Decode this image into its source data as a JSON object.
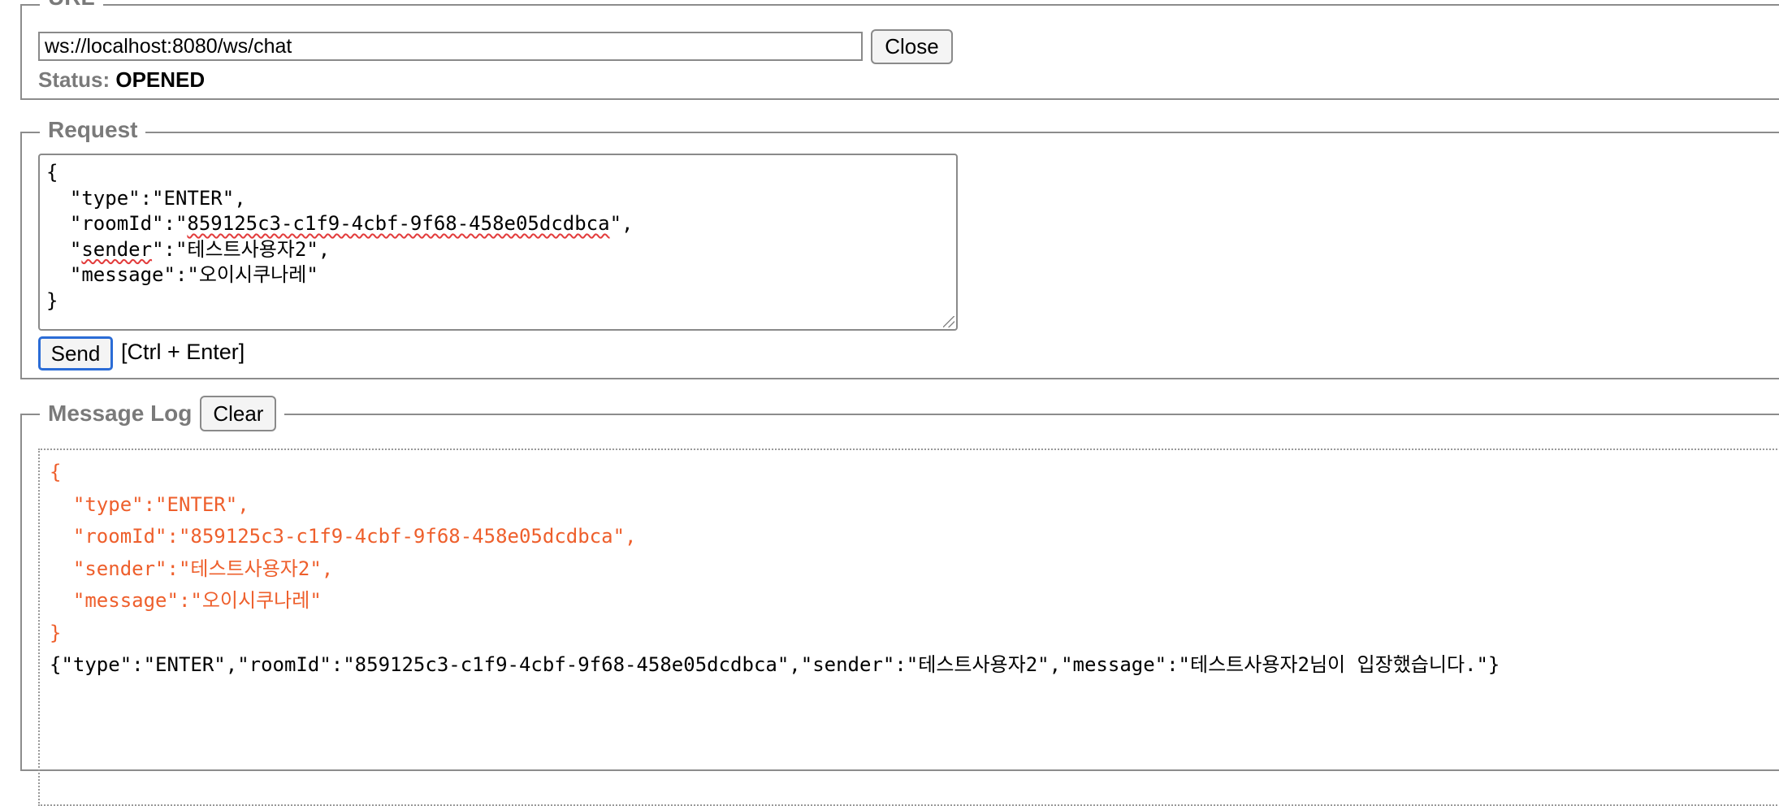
{
  "url_section": {
    "legend": "URL",
    "url_value": "ws://localhost:8080/ws/chat",
    "close_label": "Close",
    "status_label": "Status:",
    "status_value": "OPENED"
  },
  "request_section": {
    "legend": "Request",
    "lines": [
      "{",
      "  \"type\":\"ENTER\",",
      "  \"roomId\":\"859125c3-c1f9-4cbf-9f68-458e05dcdbca\",",
      "  \"sender\":\"테스트사용자2\",",
      "  \"message\":\"오이시쿠나레\"",
      "}"
    ],
    "send_label": "Send",
    "shortcut_hint": "[Ctrl + Enter]"
  },
  "log_section": {
    "legend": "Message Log",
    "clear_label": "Clear",
    "sent_lines": [
      "{",
      "  \"type\":\"ENTER\",",
      "  \"roomId\":\"859125c3-c1f9-4cbf-9f68-458e05dcdbca\",",
      "  \"sender\":\"테스트사용자2\",",
      "  \"message\":\"오이시쿠나레\"",
      "}"
    ],
    "received_line": "{\"type\":\"ENTER\",\"roomId\":\"859125c3-c1f9-4cbf-9f68-458e05dcdbca\",\"sender\":\"테스트사용자2\",\"message\":\"테스트사용자2님이 입장했습니다.\"}"
  },
  "colors": {
    "sent_text": "#ee5f2c",
    "legend_text": "#7a7a7a",
    "send_focus": "#2b6cd6"
  }
}
